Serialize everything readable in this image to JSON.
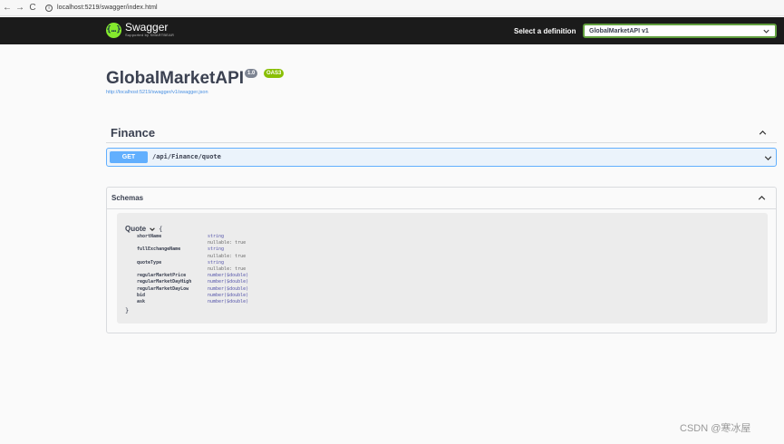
{
  "browser": {
    "back_icon": "←",
    "forward_icon": "→",
    "reload_icon": "C",
    "url": "localhost:5219/swagger/index.html"
  },
  "topbar": {
    "logo_name": "Swagger",
    "logo_sub": "Supported by SMARTBEAR",
    "definition_label": "Select a definition",
    "definition_value": "GlobalMarketAPI v1",
    "accent_color": "#62a03f"
  },
  "info": {
    "title": "GlobalMarketAPI",
    "version": "1.0",
    "oas": "OAS3",
    "spec_url": "http://localhost:5219/swagger/v1/swagger.json"
  },
  "tag": {
    "name": "Finance"
  },
  "operation": {
    "method": "GET",
    "path": "/api/Finance/quote",
    "method_color": "#61affe"
  },
  "schemas": {
    "title": "Schemas",
    "model": {
      "name": "Quote",
      "open_brace": "{",
      "close_brace": "}",
      "rows": [
        {
          "name": "shortName",
          "type": "string"
        },
        {
          "name": "",
          "type": "nullable: true"
        },
        {
          "name": "fullExchangeName",
          "type": "string"
        },
        {
          "name": "",
          "type": "nullable: true"
        },
        {
          "name": "quoteType",
          "type": "string"
        },
        {
          "name": "",
          "type": "nullable: true"
        },
        {
          "name": "regularMarketPrice",
          "type": "number($double)"
        },
        {
          "name": "regularMarketDayHigh",
          "type": "number($double)"
        },
        {
          "name": "regularMarketDayLow",
          "type": "number($double)"
        },
        {
          "name": "bid",
          "type": "number($double)"
        },
        {
          "name": "ask",
          "type": "number($double)"
        }
      ]
    }
  },
  "watermark": "CSDN @寒冰屋"
}
